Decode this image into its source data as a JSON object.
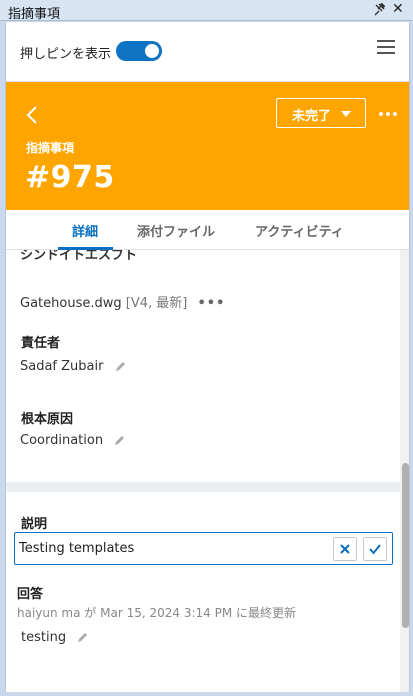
{
  "window": {
    "title": "指摘事項"
  },
  "toolbar": {
    "show_pins_label": "押しピンを表示",
    "show_pins_on": true
  },
  "header": {
    "status_label": "未完了",
    "subtitle": "指摘事項",
    "number": "#975",
    "background_color": "#ffa500"
  },
  "tabs": [
    {
      "label": "詳細",
      "active": true
    },
    {
      "label": "添付ファイル",
      "active": false
    },
    {
      "label": "アクティビティ",
      "active": false
    }
  ],
  "details": {
    "cut_heading": "シンドイトエスブト",
    "file": {
      "name": "Gatehouse.dwg",
      "version": "[V4, 最新]"
    },
    "assignee": {
      "label": "責任者",
      "value": "Sadaf Zubair"
    },
    "root_cause": {
      "label": "根本原因",
      "value": "Coordination"
    },
    "description": {
      "label": "説明",
      "value": "Testing templates"
    },
    "response": {
      "label": "回答",
      "author": "haiyun ma",
      "connector": "が",
      "timestamp": "Mar 15, 2024 3:14 PM",
      "suffix": "に最終更新",
      "value": "testing"
    }
  },
  "colors": {
    "accent": "#0a6fbe",
    "header": "#ffa500"
  }
}
